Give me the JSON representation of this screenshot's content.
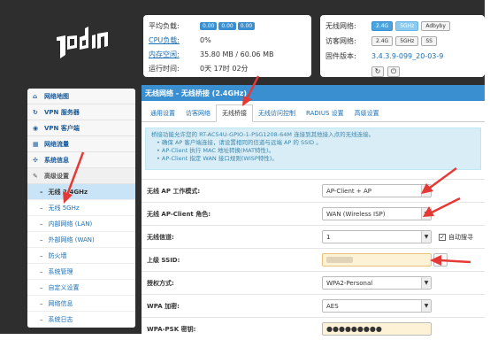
{
  "status": {
    "rows": [
      {
        "label": "平均负载:",
        "value": "",
        "pills": [
          "0.00",
          "0.00",
          "0.00"
        ],
        "link": false
      },
      {
        "label": "CPU负载:",
        "value": "0%",
        "pills": [],
        "link": true
      },
      {
        "label": "内存空闲:",
        "value": "35.80 MB / 60.06 MB",
        "pills": [],
        "link": true
      },
      {
        "label": "运行时间:",
        "value": "0天 17时 02分",
        "pills": [],
        "link": false
      }
    ]
  },
  "wifi": {
    "network_label": "无线网络:",
    "network_buttons": [
      "2.4G",
      "5GHz",
      "Adbyby"
    ],
    "guest_label": "访客网络:",
    "guest_buttons": [
      "2.4G",
      "5GHz",
      "SS"
    ],
    "firmware_label": "固件版本:",
    "firmware_value": "3.4.3.9-099_20-03-9"
  },
  "menu": [
    {
      "label": "网络地图",
      "icon": "home-icon"
    },
    {
      "label": "VPN 服务器",
      "icon": "refresh-icon"
    },
    {
      "label": "VPN 客户端",
      "icon": "globe-icon"
    },
    {
      "label": "网络流量",
      "icon": "chart-icon"
    },
    {
      "label": "系统信息",
      "icon": "arrows-icon"
    },
    {
      "label": "高级设置",
      "icon": "wrench-icon"
    }
  ],
  "submenu": [
    {
      "label": "无线 2.4GHz",
      "active": true
    },
    {
      "label": "无线 5GHz",
      "active": false
    },
    {
      "label": "内部网络 (LAN)",
      "active": false
    },
    {
      "label": "外部网络 (WAN)",
      "active": false
    },
    {
      "label": "防火墙",
      "active": false
    },
    {
      "label": "系统管理",
      "active": false
    },
    {
      "label": "自定义设置",
      "active": false
    },
    {
      "label": "网络信息",
      "active": false
    },
    {
      "label": "系统日志",
      "active": false
    }
  ],
  "main": {
    "title": "无线网络 - 无线桥接 (2.4GHz)",
    "tabs": [
      "通用设置",
      "访客网络",
      "无线桥接",
      "无线访问控制",
      "RADIUS 设置",
      "高级设置"
    ],
    "info_lines": [
      "桥接功能允许您的 RT-AC54U-GPIO-1-PSG1208-64M 连接到其他接入点的无线连接。",
      "• 确保 AP 客户端连接，请设置相同的信道与远端 AP 的 SSID 。",
      "• AP-Client 执行 MAC 地址转换(MAT特性)。",
      "• AP-Client 指定 WAN 接口规则(WISP特性)。"
    ],
    "fields": {
      "ap_mode_label": "无线 AP 工作模式:",
      "ap_mode_value": "AP-Client + AP",
      "role_label": "无线 AP-Client 角色:",
      "role_value": "WAN (Wireless ISP)",
      "channel_label": "无线信道:",
      "channel_value": "1",
      "auto_search_label": "自动搜寻",
      "ssid_label": "上级 SSID:",
      "auth_label": "授权方式:",
      "auth_value": "WPA2-Personal",
      "wpa_enc_label": "WPA 加密:",
      "wpa_enc_value": "AES",
      "psk_label": "WPA-PSK 密钥:",
      "psk_value": "●●●●●●●●●"
    }
  },
  "colors": {
    "accent": "#3a8fd0",
    "arrow": "#e53935",
    "background": "#2e2e2e"
  }
}
